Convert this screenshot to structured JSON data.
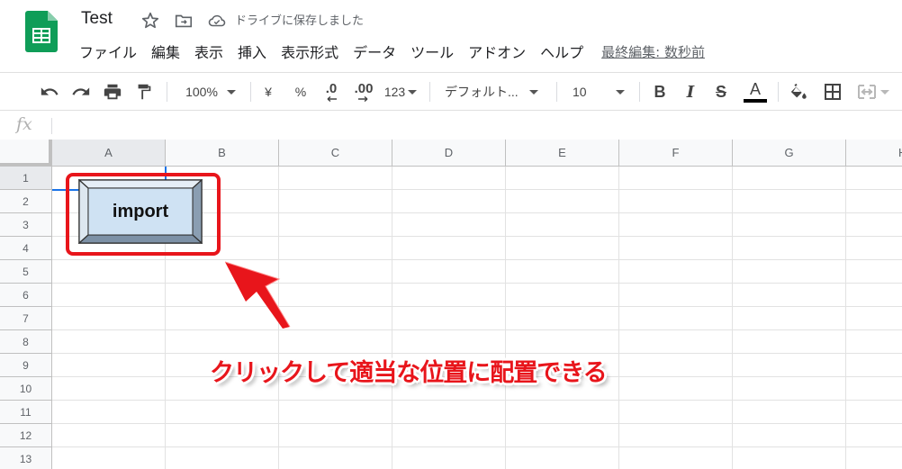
{
  "document": {
    "title": "Test",
    "save_status": "ドライブに保存しました"
  },
  "menu": {
    "items": [
      "ファイル",
      "編集",
      "表示",
      "挿入",
      "表示形式",
      "データ",
      "ツール",
      "アドオン",
      "ヘルプ"
    ],
    "last_edit": "最終編集: 数秒前"
  },
  "toolbar": {
    "zoom": "100%",
    "currency": "¥",
    "percent": "%",
    "decrease_decimal": ".0",
    "increase_decimal": ".00",
    "more_formats": "123",
    "font": "デフォルト...",
    "font_size": "10",
    "bold": "B",
    "italic": "I",
    "strikethrough": "S",
    "text_color_label": "A",
    "text_color": "#000000"
  },
  "formula_bar": {
    "fx": "fx",
    "value": ""
  },
  "grid": {
    "columns": [
      "A",
      "B",
      "C",
      "D",
      "E",
      "F",
      "G",
      "H"
    ],
    "rows": [
      "1",
      "2",
      "3",
      "4",
      "5",
      "6",
      "7",
      "8",
      "9",
      "10",
      "11",
      "12",
      "13"
    ],
    "active_cell": "A1"
  },
  "drawing": {
    "button_label": "import",
    "fill_color": "#cfe2f3"
  },
  "annotation": {
    "text": "クリックして適当な位置に配置できる",
    "color": "#e8151b"
  },
  "colors": {
    "sheets_green": "#0f9d58",
    "selection_blue": "#1a73e8"
  }
}
